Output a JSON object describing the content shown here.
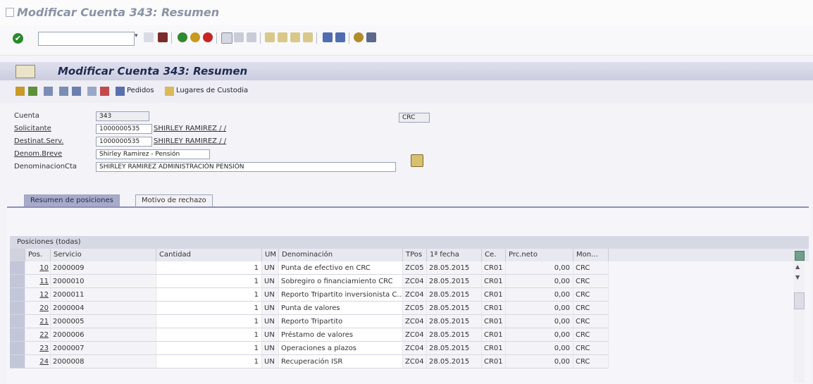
{
  "window": {
    "title": "Modificar Cuenta 343: Resumen"
  },
  "toolbar": {
    "command_field": ""
  },
  "screen": {
    "title": "Modificar Cuenta 343: Resumen"
  },
  "app_toolbar": {
    "pedidos_label": "Pedidos",
    "custodia_label": "Lugares de Custodia"
  },
  "form": {
    "cuenta_label": "Cuenta",
    "cuenta_value": "343",
    "currency": "CRC",
    "solicitante_label": "Solicitante",
    "solicitante_code": "1000000535",
    "solicitante_name": "SHIRLEY RAMIREZ / /",
    "destinat_label": "Destinat.Serv.",
    "destinat_code": "1000000535",
    "destinat_name": "SHIRLEY RAMIREZ / /",
    "denom_breve_label": "Denom.Breve",
    "denom_breve_value": "Shirley Ramirez - Pensión",
    "denom_cta_label": "DenominacionCta",
    "denom_cta_value": "SHIRLEY RAMIREZ ADMINISTRACIÓN PENSIÓN"
  },
  "tabs": [
    {
      "label": "Resumen de posiciones"
    },
    {
      "label": "Motivo de rechazo"
    }
  ],
  "grid": {
    "title": "Posiciones (todas)",
    "columns": [
      "Pos.",
      "Servicio",
      "Cantidad",
      "UM",
      "Denominación",
      "TPos",
      "1ª fecha",
      "Ce.",
      "Prc.neto",
      "Mon..."
    ],
    "rows": [
      {
        "pos": "10",
        "servicio": "2000009",
        "cantidad": "1",
        "um": "UN",
        "denominacion": "Punta de efectivo en CRC",
        "tpos": "ZC05",
        "fecha": "28.05.2015",
        "ce": "CR01",
        "prc": "0,00",
        "mon": "CRC"
      },
      {
        "pos": "11",
        "servicio": "2000010",
        "cantidad": "1",
        "um": "UN",
        "denominacion": "Sobregiro o financiamiento CRC",
        "tpos": "ZC04",
        "fecha": "28.05.2015",
        "ce": "CR01",
        "prc": "0,00",
        "mon": "CRC"
      },
      {
        "pos": "12",
        "servicio": "2000011",
        "cantidad": "1",
        "um": "UN",
        "denominacion": "Reporto Tripartito inversionista C...",
        "tpos": "ZC04",
        "fecha": "28.05.2015",
        "ce": "CR01",
        "prc": "0,00",
        "mon": "CRC"
      },
      {
        "pos": "20",
        "servicio": "2000004",
        "cantidad": "1",
        "um": "UN",
        "denominacion": "Punta de valores",
        "tpos": "ZC05",
        "fecha": "28.05.2015",
        "ce": "CR01",
        "prc": "0,00",
        "mon": "CRC"
      },
      {
        "pos": "21",
        "servicio": "2000005",
        "cantidad": "1",
        "um": "UN",
        "denominacion": "Reporto Tripartito",
        "tpos": "ZC04",
        "fecha": "28.05.2015",
        "ce": "CR01",
        "prc": "0,00",
        "mon": "CRC"
      },
      {
        "pos": "22",
        "servicio": "2000006",
        "cantidad": "1",
        "um": "UN",
        "denominacion": "Préstamo de valores",
        "tpos": "ZC04",
        "fecha": "28.05.2015",
        "ce": "CR01",
        "prc": "0,00",
        "mon": "CRC"
      },
      {
        "pos": "23",
        "servicio": "2000007",
        "cantidad": "1",
        "um": "UN",
        "denominacion": "Operaciones a plazos",
        "tpos": "ZC04",
        "fecha": "28.05.2015",
        "ce": "CR01",
        "prc": "0,00",
        "mon": "CRC"
      },
      {
        "pos": "24",
        "servicio": "2000008",
        "cantidad": "1",
        "um": "UN",
        "denominacion": "Recuperación ISR",
        "tpos": "ZC04",
        "fecha": "28.05.2015",
        "ce": "CR01",
        "prc": "0,00",
        "mon": "CRC"
      }
    ]
  }
}
